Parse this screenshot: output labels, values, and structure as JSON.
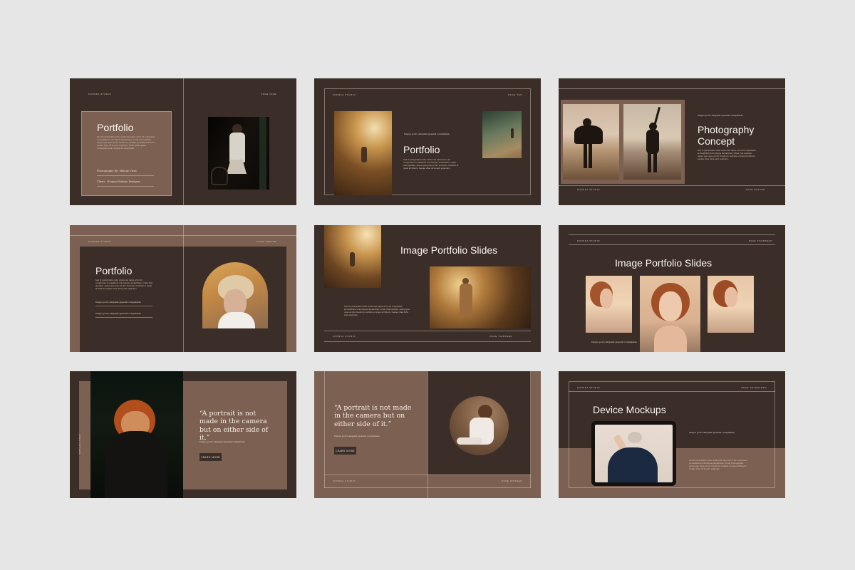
{
  "colors": {
    "background": "#e6e6e6",
    "dark": "#3b2e28",
    "tan": "#7c6152",
    "text": "#f5ebe2"
  },
  "slides": [
    {
      "studio": "FONSKA STUDIO",
      "page": "PAGE NINE",
      "title": "Portfolio",
      "body": "Sed ut perspiciatis unde omnis iste natus error sit voluptatem accusantium doloremque laudantium, totam rem aperiam, eaque ipsa quae ab illo inventore veritatis et quasi architecto beatae vitae dicta sunt explicabo. Nemo enim ipsam voluptatem quia voluptas sit aspernatur.",
      "credit1": "Photography By: Melany Vivas",
      "credit2": "Client : Hooper Fashion Designer"
    },
    {
      "studio": "FONSKA STUDIO",
      "page": "PAGE TEN",
      "quote": "Neque porro aliquam quaerat voluptatem.",
      "title": "Portfolio",
      "body": "Sed ut perspiciatis unde omnis iste natus error sit voluptatem accusantium doloremque laudantium, totam rem aperiam, eaque ipsa quae ab illo inventore veritatis et quasi architecto beatae vitae dicta sunt explicabo."
    },
    {
      "studio": "FONSKA STUDIO",
      "page": "PAGE ELEVEN",
      "quote": "Neque porro aliquam quaerat voluptatem.",
      "title_line1": "Photography",
      "title_line2": "Concept",
      "body": "Sed ut perspiciatis unde omnis iste natus error sit voluptatem accusantium doloremque laudantium, totam rem aperiam, eaque ipsa quae ab illo inventore veritatis et quasi architecto beatae vitae dicta sunt explicabo."
    },
    {
      "studio": "FONSKA STUDIO",
      "page": "PAGE TWELVE",
      "title": "Portfolio",
      "body": "Sed ut perspiciatis unde omnis iste natus error sit voluptatem accusantium doloremque laudantium, totam rem aperiam, eaque ipsa quae ab illo inventore veritatis et quasi architecto beatae vitae dicta sunt explicabo.",
      "quote1": "Neque porro aliquam quaerat voluptatem.",
      "quote2": "Neque porro aliquam quaerat voluptatem."
    },
    {
      "studio": "FONSKA STUDIO",
      "page": "PAGE THIRTEEN",
      "title": "Image Portfolio Slides",
      "body": "Sed ut perspiciatis unde omnis iste natus error sit voluptatem accusantium doloremque laudantium, totam rem aperiam, eaque ipsa quae ab illo inventore veritatis et quasi architecto beatae vitae dicta sunt explicabo."
    },
    {
      "studio": "FONSKA STUDIO",
      "page": "PAGE FOURTEEN",
      "title": "Image Portfolio Slides",
      "caption": "Neque porro aliquam quaerat voluptatem."
    },
    {
      "page": "PAGE FIFTEEN",
      "quote": "“A portrait is not made in the camera but on either side of it.”",
      "caption": "Neque porro aliquam quaerat voluptatem.",
      "button": "LEARN MORE"
    },
    {
      "studio": "FONSKA STUDIO",
      "page": "PAGE SIXTEEN",
      "quote": "“A portrait is not made in the camera but on either side of it.”",
      "caption": "Neque porro aliquam quaerat voluptatem.",
      "button": "LEARN MORE"
    },
    {
      "studio": "FONSKA STUDIO",
      "page": "PAGE SEVENTEEN",
      "title": "Device Mockups",
      "quote": "Neque porro aliquam quaerat voluptatem.",
      "body": "Sed ut perspiciatis unde omnis iste natus error sit voluptatem accusantium doloremque laudantium, totam rem aperiam, eaque ipsa quae ab illo inventore veritatis et quasi architecto beatae vitae dicta sunt explicabo."
    }
  ]
}
